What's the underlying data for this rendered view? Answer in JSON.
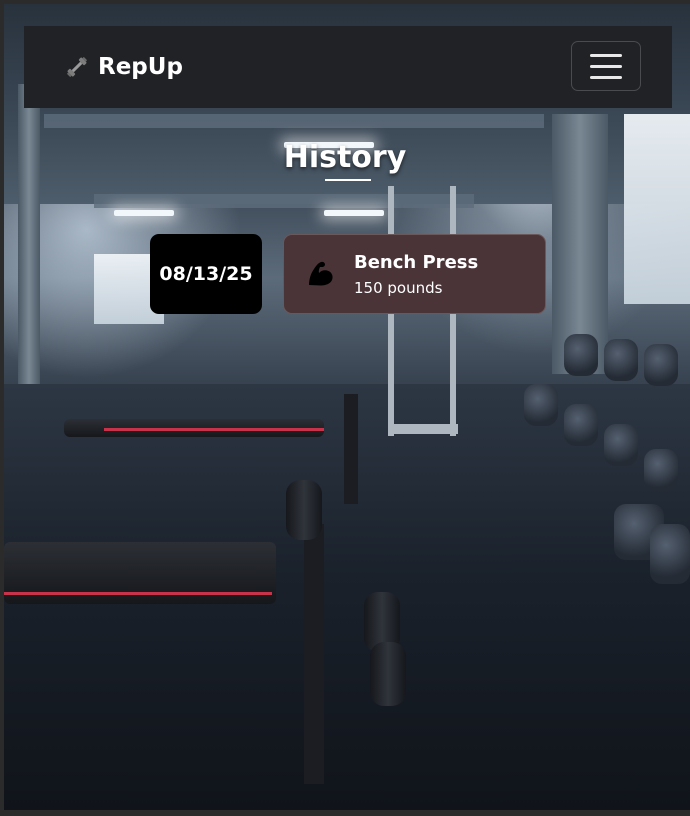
{
  "navbar": {
    "brand": "RepUp",
    "brand_icon": "dumbbell-icon",
    "menu_icon": "hamburger-menu-icon"
  },
  "page": {
    "title": "History"
  },
  "history": {
    "entries": [
      {
        "date": "08/13/25",
        "exercise": "Bench Press",
        "weight": "150 pounds",
        "icon": "flexed-biceps-icon"
      }
    ]
  },
  "colors": {
    "navbar_bg": "#212225",
    "date_badge_bg": "#000000",
    "entry_card_bg": "#4a3438",
    "text": "#ffffff"
  }
}
